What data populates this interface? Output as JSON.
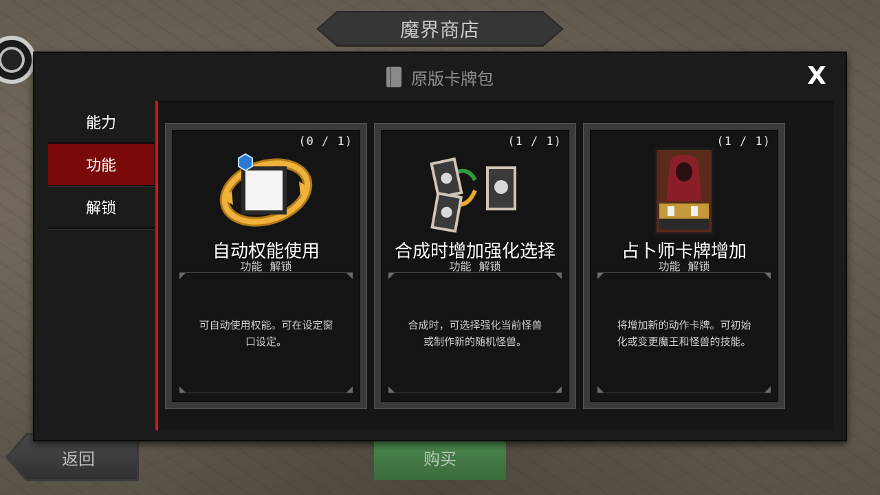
{
  "shop_title": "魔界商店",
  "panel": {
    "title": "原版卡牌包",
    "close_label": "X"
  },
  "sidebar": {
    "items": [
      {
        "label": "能力",
        "active": false
      },
      {
        "label": "功能",
        "active": true
      },
      {
        "label": "解锁",
        "active": false
      }
    ]
  },
  "cards": [
    {
      "count": "(0 / 1)",
      "title": "自动权能使用",
      "subtitle": "功能 解锁",
      "description": "可自动使用权能。可在设定窗口设定。",
      "icon": "auto-cycle-icon"
    },
    {
      "count": "(1 / 1)",
      "title": "合成时增加强化选择",
      "subtitle": "功能 解锁",
      "description": "合成时，可选择强化当前怪兽或制作新的随机怪兽。",
      "icon": "card-merge-icon"
    },
    {
      "count": "(1 / 1)",
      "title": "占卜师卡牌增加",
      "subtitle": "功能 解锁",
      "description": "将增加新的动作卡牌。可初始化或变更魔王和怪兽的技能。",
      "icon": "fortune-teller-card-icon"
    }
  ],
  "buttons": {
    "back_label": "返回",
    "buy_label": "购买"
  },
  "colors": {
    "active_tab": "#7a0a0a",
    "accent_bar": "#d21414",
    "buy_button": "#4e8a50"
  }
}
